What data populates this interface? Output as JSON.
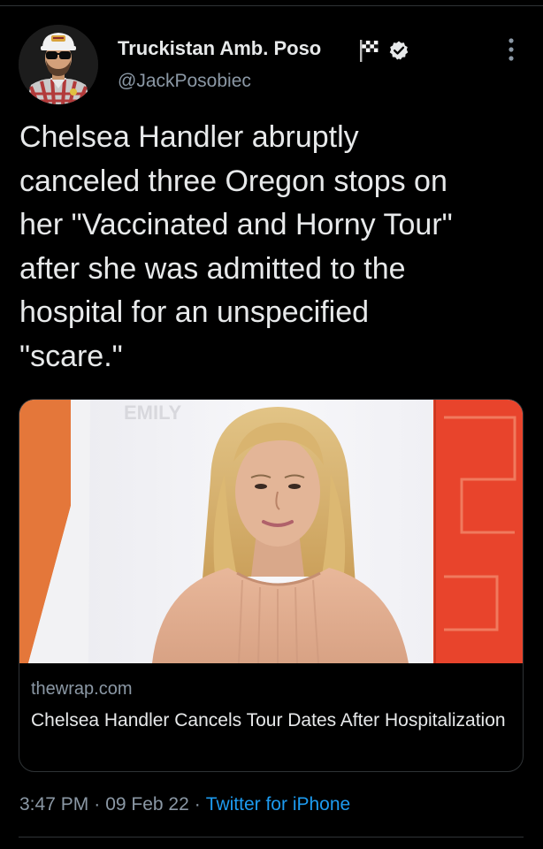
{
  "author": {
    "display_name": "Truckistan Amb. Poso",
    "handle": "@JackPosobiec",
    "verified": true,
    "name_emoji_icon": "chequered-flag-icon",
    "avatar_icon": "profile-photo"
  },
  "tweet": {
    "text": "Chelsea Handler abruptly\ncanceled three Oregon stops on\nher \"Vaccinated and Horny Tour\"\nafter she was admitted to the\nhospital for an unspecified\n\"scare.\""
  },
  "link_card": {
    "domain": "thewrap.com",
    "title": "Chelsea Handler Cancels Tour Dates After Hospitalization",
    "image_backdrop_text": "EMILY"
  },
  "meta": {
    "time": "3:47 PM",
    "date": "09 Feb 22",
    "separator": "·",
    "source": "Twitter for iPhone"
  },
  "colors": {
    "background": "#000000",
    "text_primary": "#e7e9ea",
    "text_secondary": "#8b98a5",
    "accent_link": "#1d9bf0",
    "border": "#2f3336"
  }
}
